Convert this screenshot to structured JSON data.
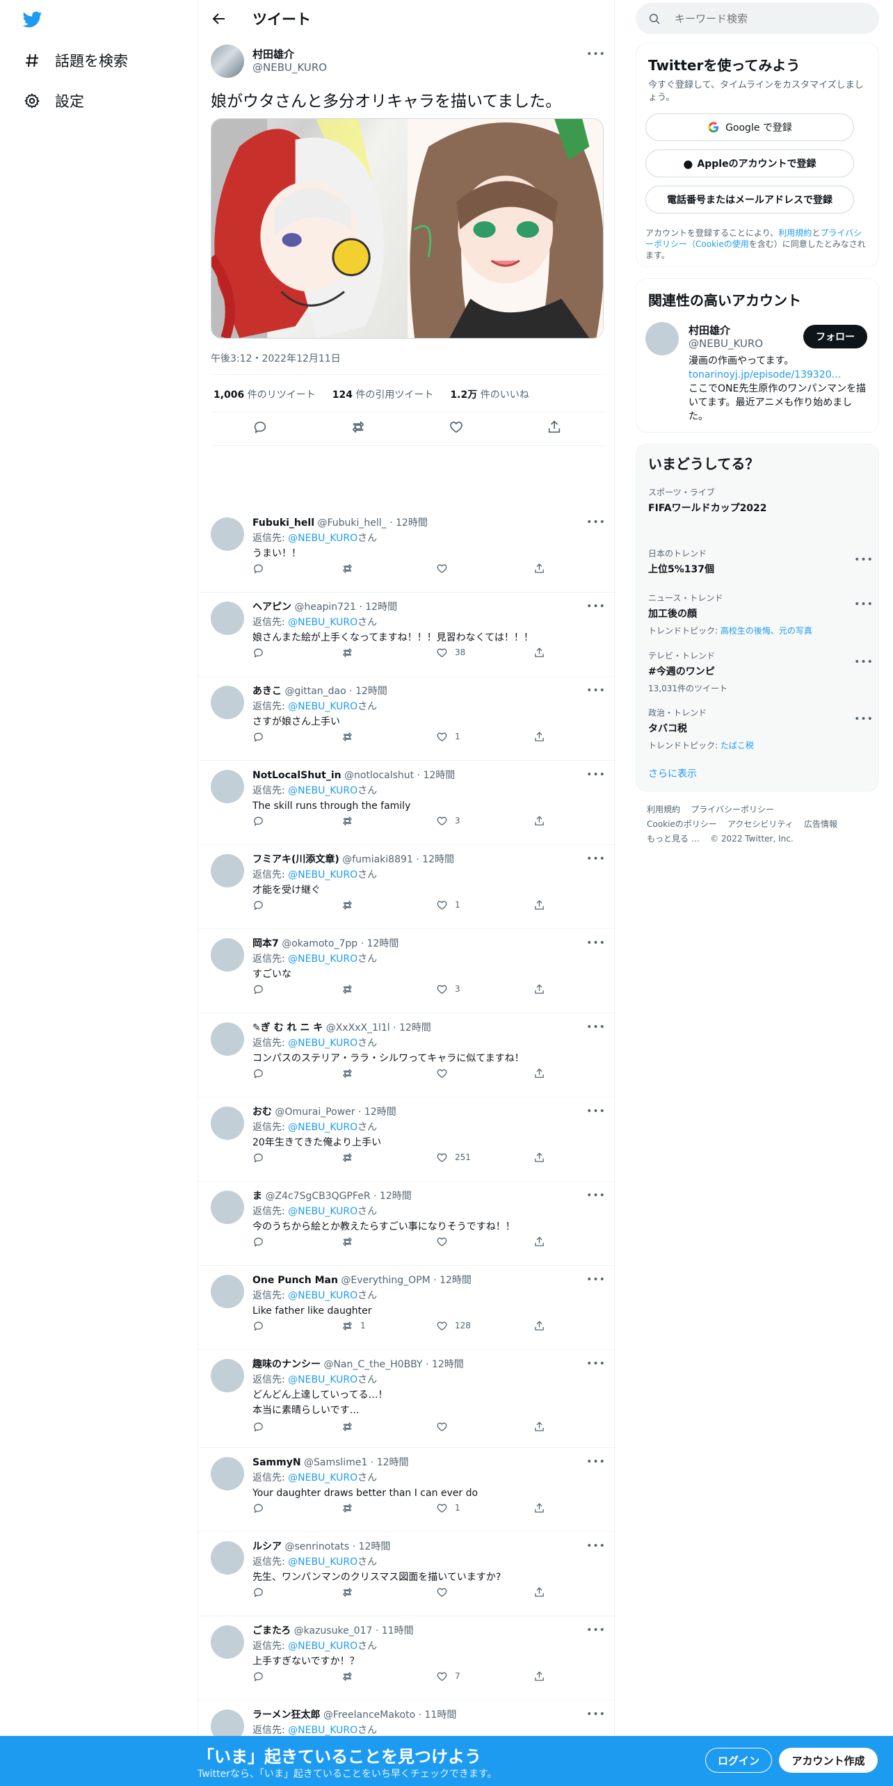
{
  "nav": {
    "explore_label": "話題を検索",
    "settings_label": "設定"
  },
  "header": {
    "title": "ツイート"
  },
  "tweet": {
    "author_name": "村田雄介",
    "author_handle": "@NEBU_KURO",
    "text": "娘がウタさんと多分オリキャラを描いてました。",
    "timestamp": "午後3:12・2022年12月11日",
    "retweets": "1,006",
    "retweets_label": "件のリツイート",
    "quotes": "124",
    "quotes_label": "件の引用ツイート",
    "likes": "1.2万",
    "likes_label": "件のいいね"
  },
  "replies": [
    {
      "name": "Fubuki_hell",
      "handle": "@Fubuki_hell_",
      "time": "12時間",
      "to_prefix": "返信先: ",
      "to": "@NEBU_KURO",
      "to_suffix": "さん",
      "text": "うまい！！",
      "rt": "",
      "like": ""
    },
    {
      "name": "ヘアピン",
      "handle": "@heapin721",
      "time": "12時間",
      "to_prefix": "返信先: ",
      "to": "@NEBU_KURO",
      "to_suffix": "さん",
      "text": "娘さんまた絵が上手くなってますね！！！見習わなくては！！！",
      "rt": "",
      "like": "38"
    },
    {
      "name": "あきこ",
      "handle": "@gittan_dao",
      "time": "12時間",
      "to_prefix": "返信先: ",
      "to": "@NEBU_KURO",
      "to_suffix": "さん",
      "text": "さすが娘さん上手い",
      "rt": "",
      "like": "1"
    },
    {
      "name": "NotLocalShut_in",
      "handle": "@notlocalshut",
      "time": "12時間",
      "to_prefix": "返信先: ",
      "to": "@NEBU_KURO",
      "to_suffix": "さん",
      "text": "The skill runs through the family",
      "rt": "",
      "like": "3"
    },
    {
      "name": "フミアキ(川添文章)",
      "handle": "@fumiaki8891",
      "time": "12時間",
      "to_prefix": "返信先: ",
      "to": "@NEBU_KURO",
      "to_suffix": "さん",
      "text": "才能を受け継ぐ",
      "rt": "",
      "like": "1"
    },
    {
      "name": "岡本7",
      "handle": "@okamoto_7pp",
      "time": "12時間",
      "to_prefix": "返信先: ",
      "to": "@NEBU_KURO",
      "to_suffix": "さん",
      "text": "すごいな",
      "rt": "",
      "like": "3"
    },
    {
      "name": "✎ぎ む れ ニ キ",
      "handle": "@XxXxX_1l1l",
      "time": "12時間",
      "to_prefix": "返信先: ",
      "to": "@NEBU_KURO",
      "to_suffix": "さん",
      "text": "コンパスのステリア・ララ・シルワってキャラに似てますね！",
      "rt": "",
      "like": ""
    },
    {
      "name": "おむ",
      "handle": "@Omurai_Power",
      "time": "12時間",
      "to_prefix": "返信先: ",
      "to": "@NEBU_KURO",
      "to_suffix": "さん",
      "text": "20年生きてきた俺より上手い",
      "rt": "",
      "like": "251"
    },
    {
      "name": "ま",
      "handle": "@Z4c7SgCB3QGPFeR",
      "time": "12時間",
      "to_prefix": "返信先: ",
      "to": "@NEBU_KURO",
      "to_suffix": "さん",
      "text": "今のうちから絵とか教えたらすごい事になりそうですね！！",
      "rt": "",
      "like": ""
    },
    {
      "name": "One Punch Man",
      "handle": "@Everything_OPM",
      "time": "12時間",
      "to_prefix": "返信先: ",
      "to": "@NEBU_KURO",
      "to_suffix": "さん",
      "text": "Like father like daughter",
      "rt": "1",
      "like": "128"
    },
    {
      "name": "趣味のナンシー",
      "handle": "@Nan_C_the_H0BBY",
      "time": "12時間",
      "to_prefix": "返信先: ",
      "to": "@NEBU_KURO",
      "to_suffix": "さん",
      "text": "どんどん上達していってる…！",
      "text2": "本当に素晴らしいです…",
      "rt": "",
      "like": ""
    },
    {
      "name": "SammyN",
      "handle": "@Samslime1",
      "time": "12時間",
      "to_prefix": "返信先: ",
      "to": "@NEBU_KURO",
      "to_suffix": "さん",
      "text": "Your daughter draws better than I can ever do",
      "rt": "",
      "like": "1"
    },
    {
      "name": "ルシア",
      "handle": "@senrinotats",
      "time": "12時間",
      "to_prefix": "返信先: ",
      "to": "@NEBU_KURO",
      "to_suffix": "さん",
      "text": "先生、ワンパンマンのクリスマス図面を描いていますか?",
      "rt": "",
      "like": ""
    },
    {
      "name": "ごまたろ",
      "handle": "@kazusuke_017",
      "time": "11時間",
      "to_prefix": "返信先: ",
      "to": "@NEBU_KURO",
      "to_suffix": "さん",
      "text": "上手すぎないですか！？",
      "rt": "",
      "like": "7"
    },
    {
      "name": "ラーメン狂太郎",
      "handle": "@FreelanceMakoto",
      "time": "11時間",
      "to_prefix": "返信先: ",
      "to": "@NEBU_KURO",
      "to_suffix": "さん",
      "text": "",
      "rt": "",
      "like": ""
    }
  ],
  "search": {
    "placeholder": "キーワード検索"
  },
  "signup": {
    "title": "Twitterを使ってみよう",
    "subtitle": "今すぐ登録して、タイムラインをカスタマイズしましょう。",
    "google": "Google で登録",
    "apple": "Appleのアカウントで登録",
    "phone": "電話番号またはメールアドレスで登録",
    "legal_1": "アカウントを登録することにより、",
    "legal_terms": "利用規約",
    "legal_and": "と",
    "legal_privacy": "プライバシーポリシー（Cookieの使用",
    "legal_2": "を含む）に同意したとみなされます。"
  },
  "related": {
    "title": "関連性の高いアカウント",
    "name": "村田雄介",
    "handle": "@NEBU_KURO",
    "follow": "フォロー",
    "bio_1": "漫画の作画やってます。",
    "bio_link": "tonarinoyj.jp/episode/139320…",
    "bio_2": "ここでONE先生原作のワンパンマンを描いてます。最近アニメも作り始めました。"
  },
  "trends": {
    "title": "いまどうしてる？",
    "items": [
      {
        "cat": "スポーツ・ライブ",
        "name": "FIFAワールドカップ2022",
        "sub": "",
        "sub_link": ""
      },
      {
        "cat": "日本のトレンド",
        "name": "上位5%137個",
        "sub": "",
        "sub_link": ""
      },
      {
        "cat": "ニュース・トレンド",
        "name": "加工後の顔",
        "sub": "トレンドトピック: ",
        "sub_link": "高校生の後悔、元の写真"
      },
      {
        "cat": "テレビ・トレンド",
        "name": "#今週のワンピ",
        "sub": "13,031件のツイート",
        "sub_link": ""
      },
      {
        "cat": "政治・トレンド",
        "name": "タバコ税",
        "sub": "トレンドトピック: ",
        "sub_link": "たばこ税"
      }
    ],
    "show_more": "さらに表示"
  },
  "footer": {
    "terms": "利用規約",
    "privacy": "プライバシーポリシー",
    "cookie": "Cookieのポリシー",
    "accessibility": "アクセシビリティ",
    "ads": "広告情報",
    "more": "もっと見る …",
    "copyright": "© 2022 Twitter, Inc."
  },
  "banner": {
    "title": "「いま」起きていることを見つけよう",
    "subtitle": "Twitterなら、「いま」起きていることをいち早くチェックできます。",
    "login": "ログイン",
    "create": "アカウント作成"
  },
  "colors": {
    "accent": "#1d9bf0",
    "text": "#0f1419",
    "muted": "#536471",
    "border": "#eff3f4"
  }
}
